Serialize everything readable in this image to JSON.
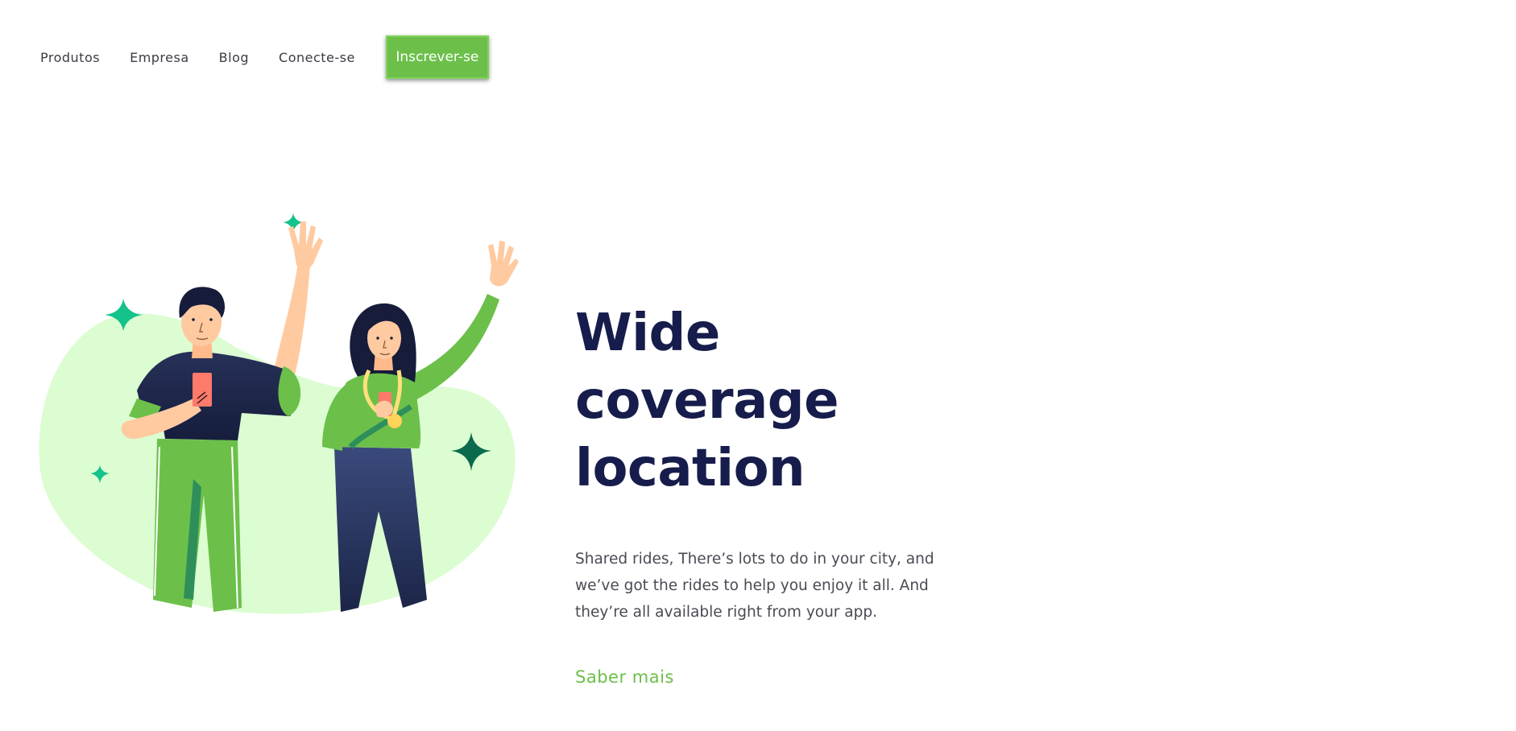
{
  "nav": {
    "items": [
      {
        "label": "Produtos"
      },
      {
        "label": "Empresa"
      },
      {
        "label": "Blog"
      },
      {
        "label": "Conecte-se"
      }
    ],
    "signup_label": "Inscrever-se"
  },
  "hero": {
    "title_line1": "Wide coverage",
    "title_line2": "location",
    "description": "Shared rides, There’s lots to do in your city, and we’ve got the rides to help you enjoy it all. And they’re all available right from your app.",
    "link_label": "Saber mais"
  },
  "colors": {
    "brand_green": "#6cc04a",
    "title_navy": "#161c4b",
    "blob_green": "#dbfdd1",
    "sparkle_teal": "#14c28b"
  },
  "icons": {
    "illustration": "two-people-waving-illustration",
    "sparkles": "sparkle-icon"
  }
}
